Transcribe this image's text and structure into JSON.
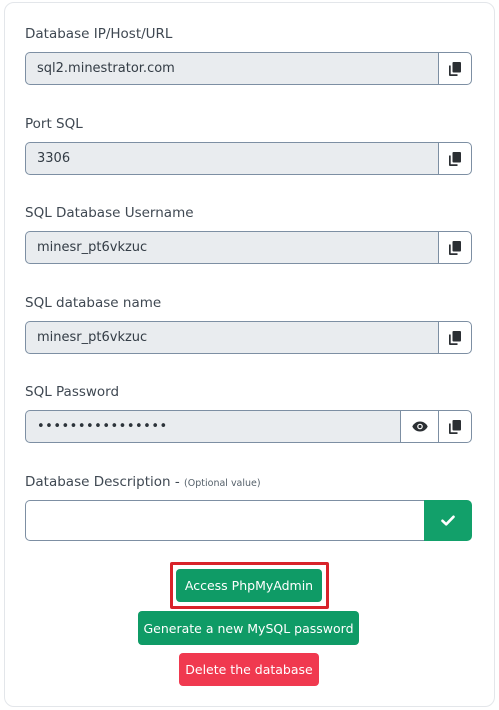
{
  "fields": [
    {
      "label": "Database IP/Host/URL",
      "value": "sql2.minestrator.com"
    },
    {
      "label": "Port SQL",
      "value": "3306"
    },
    {
      "label": "SQL Database Username",
      "value": "minesr_pt6vkzuc"
    },
    {
      "label": "SQL database name",
      "value": "minesr_pt6vkzuc"
    },
    {
      "label": "SQL Password",
      "value": "••••••••••••••••"
    }
  ],
  "description": {
    "label": "Database Description - ",
    "optional_note": "(Optional value)",
    "value": ""
  },
  "actions": {
    "phpmyadmin_label": "Access PhpMyAdmin",
    "new_password_label": "Generate a new MySQL password",
    "delete_label": "Delete the database"
  },
  "colors": {
    "green": "#0f9b66",
    "red": "#f0394f",
    "highlight": "#d8232a"
  },
  "icons": {
    "copy": "copy-icon",
    "show_password": "eye-icon",
    "confirm": "check-icon"
  }
}
